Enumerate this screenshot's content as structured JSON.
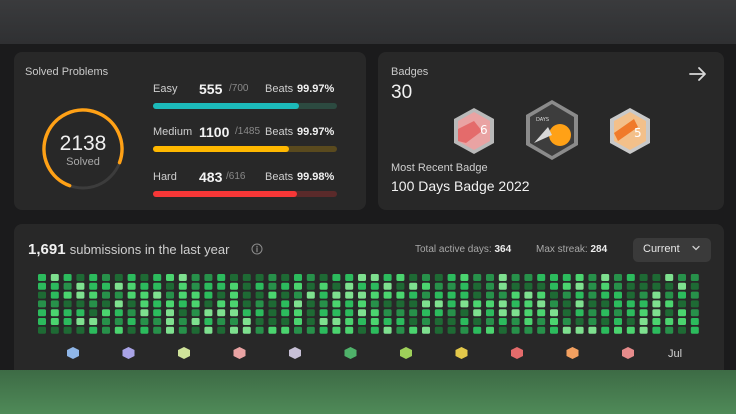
{
  "solved": {
    "title": "Solved Problems",
    "total": "2138",
    "total_label": "Solved",
    "ring_fraction": 0.75,
    "difficulties": [
      {
        "name": "Easy",
        "solved": "555",
        "total": "/700",
        "beats_label": "Beats",
        "beats": "99.97%",
        "fraction": 0.793,
        "color": "#1cbaba",
        "track": "#2c4a40"
      },
      {
        "name": "Medium",
        "solved": "1100",
        "total": "/1485",
        "beats_label": "Beats",
        "beats": "99.97%",
        "fraction": 0.741,
        "color": "#ffb800",
        "track": "#5a4a1e"
      },
      {
        "name": "Hard",
        "solved": "483",
        "total": "/616",
        "beats_label": "Beats",
        "beats": "99.98%",
        "fraction": 0.784,
        "color": "#f63737",
        "track": "#5a2a2a"
      }
    ]
  },
  "badges": {
    "title": "Badges",
    "count": "30",
    "recent_label": "Most Recent Badge",
    "recent_name": "100 Days Badge 2022",
    "items": [
      {
        "name": "6-badge-icon",
        "text": "6"
      },
      {
        "name": "days-badge-icon",
        "text": "DAYS"
      },
      {
        "name": "5-badge-icon",
        "text": "5"
      }
    ]
  },
  "submissions": {
    "count": "1,691",
    "label": "submissions in the last year",
    "active_label": "Total active days:",
    "active_value": "364",
    "streak_label": "Max streak:",
    "streak_value": "284",
    "range": "Current",
    "month_label": "Jul"
  },
  "colors": {
    "accent_green": "#2cbb5d",
    "bg": "#1b1b1c",
    "card": "#282828"
  }
}
